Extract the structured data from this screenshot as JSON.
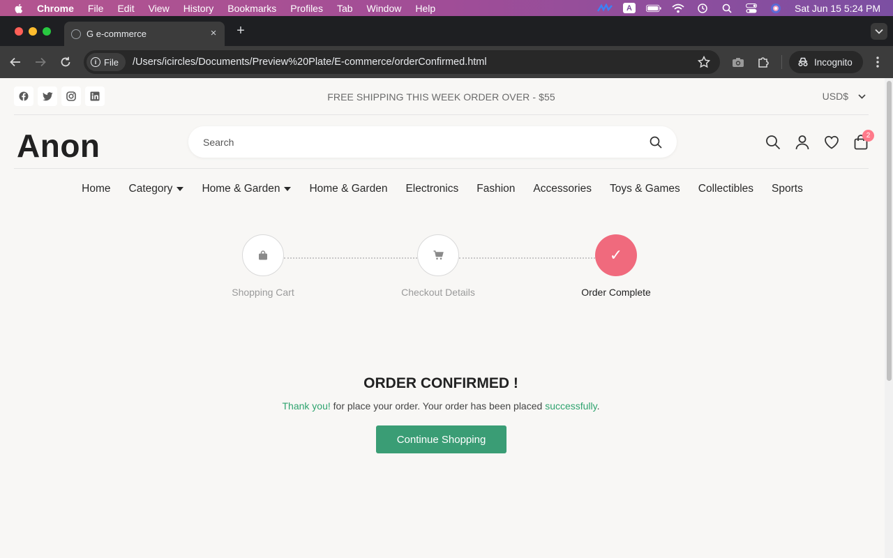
{
  "menubar": {
    "app": "Chrome",
    "items": [
      "File",
      "Edit",
      "View",
      "History",
      "Bookmarks",
      "Profiles",
      "Tab",
      "Window",
      "Help"
    ],
    "input_badge": "A",
    "clock": "Sat Jun 15  5:24 PM"
  },
  "browser": {
    "tab_title": "G e-commerce",
    "new_tab": "+",
    "close": "×",
    "chip_label": "File",
    "url": "/Users/icircles/Documents/Preview%20Plate/E-commerce/orderConfirmed.html",
    "incognito_label": "Incognito"
  },
  "page": {
    "shipping_notice": "FREE SHIPPING THIS WEEK ORDER OVER - $55",
    "currency": "USD$",
    "logo": "Anon",
    "search_placeholder": "Search",
    "cart_count": "2",
    "nav": [
      {
        "label": "Home"
      },
      {
        "label": "Category"
      },
      {
        "label": "Home & Garden"
      },
      {
        "label": "Home & Garden"
      },
      {
        "label": "Electronics"
      },
      {
        "label": "Fashion"
      },
      {
        "label": "Accessories"
      },
      {
        "label": "Toys & Games"
      },
      {
        "label": "Collectibles"
      },
      {
        "label": "Sports"
      }
    ],
    "steps": [
      {
        "label": "Shopping Cart",
        "icon": "shopping-bag-icon"
      },
      {
        "label": "Checkout Details",
        "icon": "cart-icon"
      },
      {
        "label": "Order Complete",
        "icon": "check-icon"
      }
    ],
    "check_glyph": "✓",
    "confirm_title": "ORDER CONFIRMED !",
    "confirm_thanks": "Thank you!",
    "confirm_mid": " for place your order. Your order has been placed ",
    "confirm_success": "successfully",
    "confirm_end": ".",
    "cta_label": "Continue Shopping"
  },
  "colors": {
    "menubar_gradient": [
      "#b4558f",
      "#7c4fa2"
    ],
    "accent_pink": "#f06a7d",
    "accent_green": "#3a9d75",
    "success_text": "#2ea36e",
    "badge": "#ff7a8a"
  }
}
